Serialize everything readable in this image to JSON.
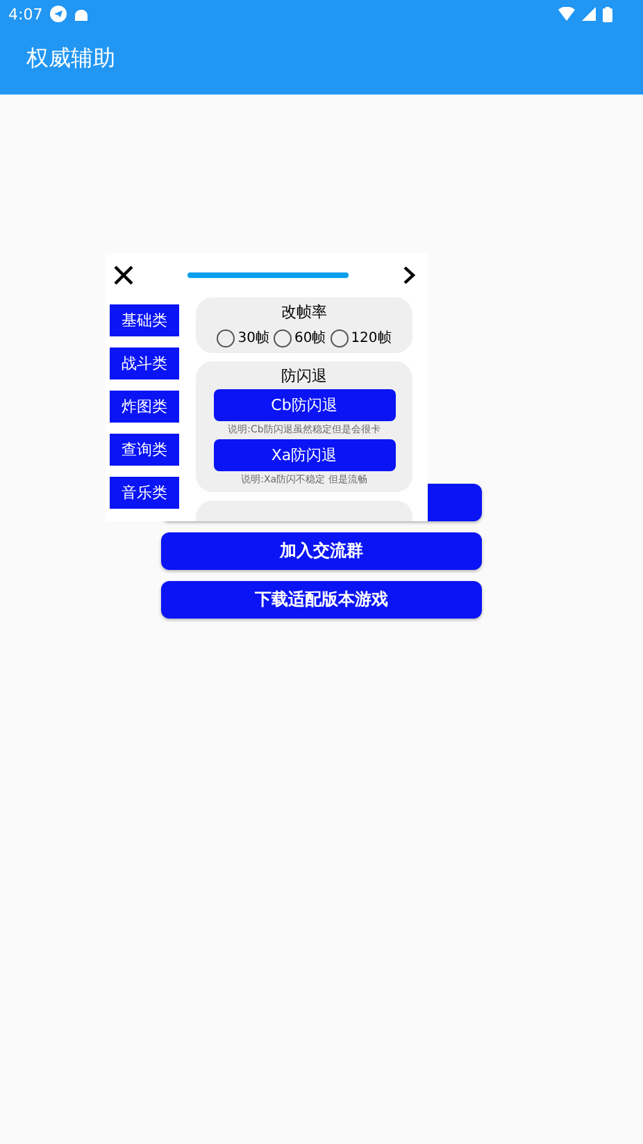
{
  "status_bar": {
    "time": "4:07"
  },
  "app_bar": {
    "title": "权威辅助"
  },
  "main_buttons": [
    {
      "label": "加入交流群"
    },
    {
      "label": "下载适配版本游戏"
    }
  ],
  "panel": {
    "categories": [
      {
        "label": "基础类"
      },
      {
        "label": "战斗类"
      },
      {
        "label": "炸图类"
      },
      {
        "label": "查询类"
      },
      {
        "label": "音乐类"
      }
    ],
    "frame_rate": {
      "title": "改帧率",
      "options": [
        {
          "label": "30帧",
          "selected": false
        },
        {
          "label": "60帧",
          "selected": false
        },
        {
          "label": "120帧",
          "selected": false
        }
      ]
    },
    "anti_crash": {
      "title": "防闪退",
      "items": [
        {
          "label": "Cb防闪退",
          "note": "说明:Cb防闪退虽然稳定但是会很卡"
        },
        {
          "label": "Xa防闪退",
          "note": "说明:Xa防闪不稳定 但是流畅"
        }
      ]
    }
  }
}
